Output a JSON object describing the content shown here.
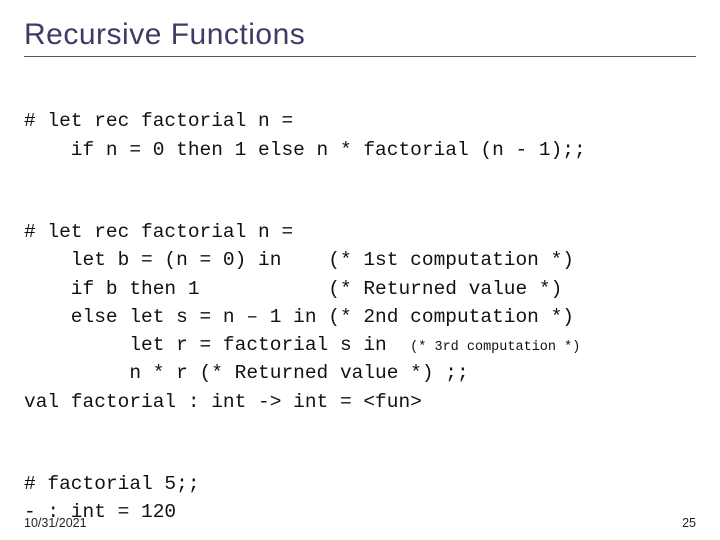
{
  "title": "Recursive Functions",
  "code1": {
    "l1": "# let rec factorial n =",
    "l2": "    if n = 0 then 1 else n * factorial (n - 1);;"
  },
  "code2": {
    "l1": "# let rec factorial n =",
    "l2": "    let b = (n = 0) in    (* 1st computation *)",
    "l3": "    if b then 1           (* Returned value *)",
    "l4": "    else let s = n – 1 in (* 2nd computation *)",
    "l5a": "         let r = factorial s in  ",
    "l5b": "(* 3rd computation *)",
    "l6": "         n * r (* Returned value *) ;;",
    "l7": "val factorial : int -> int = <fun>"
  },
  "code3": {
    "l1": "# factorial 5;;",
    "l2": "- : int = 120"
  },
  "footer": {
    "date": "10/31/2021",
    "page": "25"
  }
}
